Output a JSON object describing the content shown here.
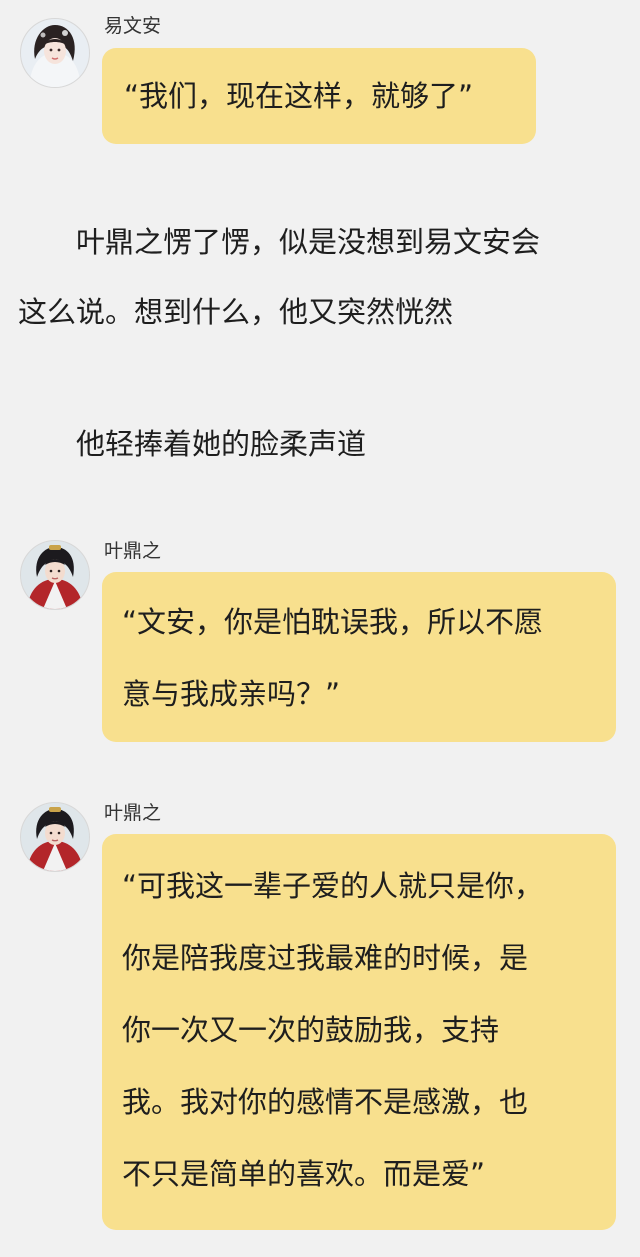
{
  "messages": [
    {
      "sender": "易文安",
      "lines": [
        "“我们，现在这样，就够了”"
      ]
    },
    {
      "sender": "叶鼎之",
      "lines": [
        "“文安，你是怕耽误我，所以不愿",
        "意与我成亲吗？”"
      ]
    },
    {
      "sender": "叶鼎之",
      "lines": [
        "“可我这一辈子爱的人就只是你，",
        "你是陪我度过我最难的时候，是",
        "你一次又一次的鼓励我，支持",
        "我。我对你的感情不是感激，也",
        "不只是简单的喜欢。而是爱”"
      ]
    }
  ],
  "narration": {
    "paragraph1": [
      "　　叶鼎之愣了愣，似是没想到易文安会",
      "这么说。想到什么，他又突然恍然"
    ],
    "paragraph2": [
      "　　他轻捧着她的脸柔声道"
    ]
  },
  "colors": {
    "background": "#f1f1f1",
    "bubble": "#f8e08e",
    "text": "#1e1e1e"
  }
}
